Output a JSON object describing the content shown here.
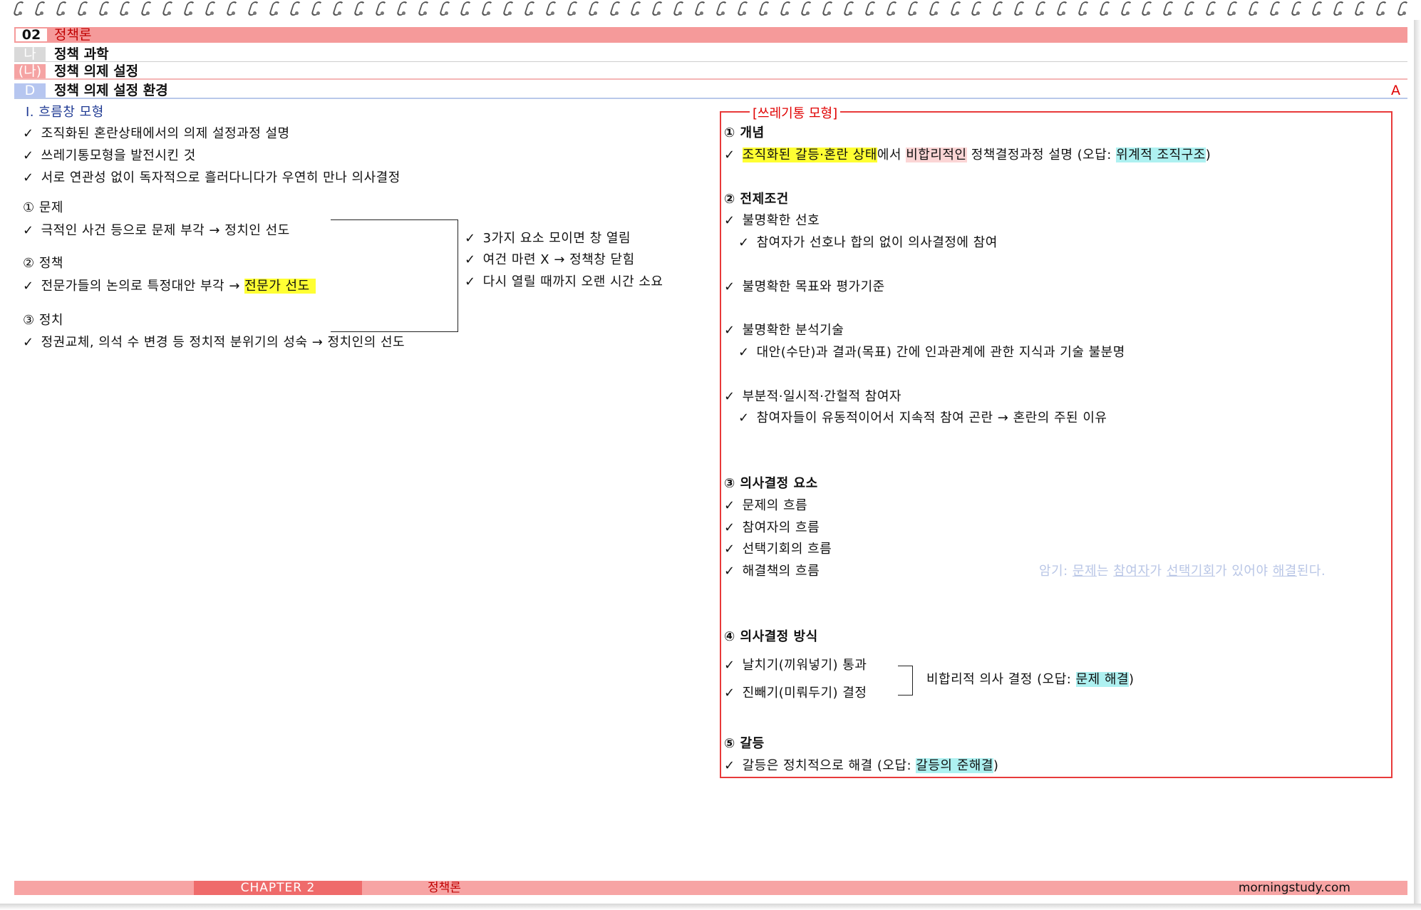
{
  "header": {
    "bar1": {
      "tag": "02",
      "title": "정책론"
    },
    "bar2": {
      "tag": "나",
      "title": "정책 과학"
    },
    "bar3": {
      "tag": "(나)",
      "title": "정책 의제 설정"
    },
    "bar4": {
      "tag": "D",
      "title": "정책 의제 설정 환경",
      "mark": "A"
    }
  },
  "left": {
    "section_title": "Ⅰ. 흐름창 모형",
    "intro": [
      "조직화된 혼란상태에서의 의제 설정과정 설명",
      "쓰레기통모형을 발전시킨 것",
      "서로 연관성 없이 독자적으로 흘러다니다가 우연히 만나 의사결정"
    ],
    "streams": [
      {
        "heading": "① 문제",
        "text": "극적인 사건 등으로 문제 부각 → 정치인 선도",
        "highlight": ""
      },
      {
        "heading": "② 정책",
        "text": "전문가들의 논의로 특정대안 부각 → ",
        "highlight": "전문가 선도"
      },
      {
        "heading": "③ 정치",
        "text": "정권교체, 의석 수 변경 등 정치적 분위기의 성숙 → 정치인의 선도",
        "highlight": ""
      }
    ],
    "window": [
      "3가지 요소 모이면 창 열림",
      "여건 마련 X → 정책창 닫힘",
      "다시 열릴 때까지 오랜 시간 소요"
    ]
  },
  "right": {
    "box_title": "[쓰레기통 모형]",
    "concept": {
      "heading": "① 개념",
      "hl1": "조직화된 갈등·혼란 상태",
      "t1": "에서 ",
      "hl2": "비합리적인",
      "t2": " 정책결정과정 설명 (오답: ",
      "hl3": "위계적 조직구조",
      "t3": ")"
    },
    "premise": {
      "heading": "② 전제조건",
      "items": [
        {
          "main": "불명확한 선호",
          "sub": "참여자가 선호나 합의 없이 의사결정에 참여"
        },
        {
          "main": "불명확한 목표와 평가기준",
          "sub": ""
        },
        {
          "main": "불명확한 분석기술",
          "sub": "대안(수단)과 결과(목표) 간에 인과관계에 관한 지식과 기술 불분명"
        },
        {
          "main": "부분적·일시적·간헐적 참여자",
          "sub": "참여자들이 유동적이어서 지속적 참여 곤란 → 혼란의 주된 이유"
        }
      ]
    },
    "elements": {
      "heading": "③ 의사결정 요소",
      "items": [
        "문제의 흐름",
        "참여자의 흐름",
        "선택기회의 흐름",
        "해결책의 흐름"
      ],
      "hint": {
        "pre": "암기: ",
        "w1": "문제",
        "a": "는 ",
        "w2": "참여자",
        "b": "가 ",
        "w3": "선택기회",
        "c": "가 있어야 ",
        "w4": "해결",
        "d": "된다."
      }
    },
    "methods": {
      "heading": "④ 의사결정 방식",
      "items": [
        "날치기(끼워넣기) 통과",
        "진빼기(미뤄두기) 결정"
      ],
      "note_pre": "비합리적 의사 결정 (오답: ",
      "note_hl": "문제 해결",
      "note_post": ")"
    },
    "conflict": {
      "heading": "⑤ 갈등",
      "text": "갈등은 정치적으로 해결 (오답: ",
      "hl": "갈등의 준해결",
      "post": ")"
    }
  },
  "footer": {
    "chapter": "CHAPTER 2",
    "title": "정책론",
    "site": "morningstudy.com"
  },
  "check_glyph": "✓"
}
